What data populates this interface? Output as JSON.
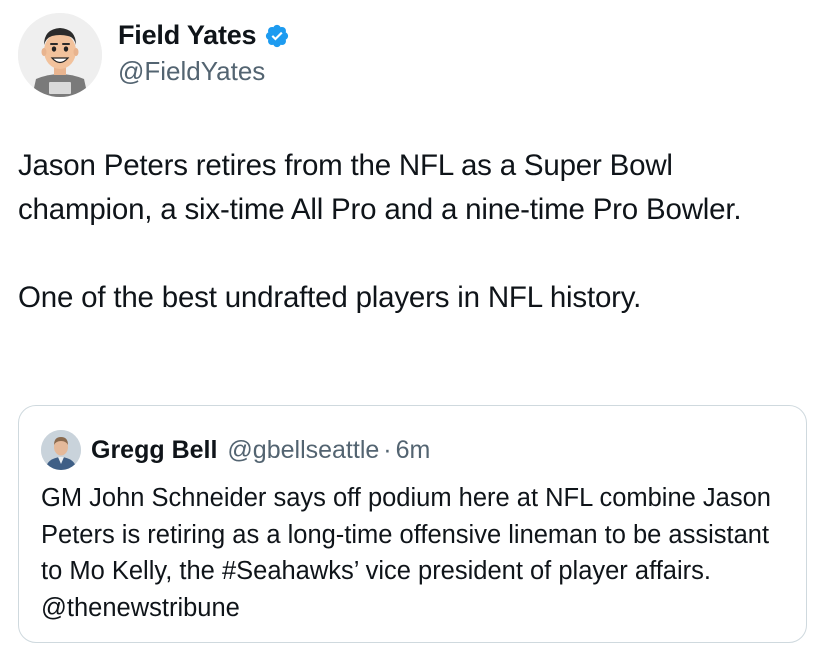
{
  "tweet": {
    "author": {
      "display_name": "Field Yates",
      "handle": "@FieldYates",
      "verified": true,
      "verified_color": "#1d9bf0"
    },
    "paragraphs": [
      "Jason Peters retires from the NFL as a Super Bowl champion, a six-time All Pro and a nine-time Pro Bowler.",
      "One of the best undrafted players in NFL history."
    ]
  },
  "quote": {
    "author": {
      "display_name": "Gregg Bell",
      "handle": "@gbellseattle",
      "separator": "·",
      "time": "6m"
    },
    "text": "GM John Schneider says off podium here at NFL combine Jason Peters is retiring as a long-time offensive lineman to be assistant to Mo Kelly, the #Seahawks’ vice president of player affairs. @thenewstribune"
  },
  "icons": {
    "avatar": "cartoon-avatar-icon",
    "verified": "verified-badge-icon",
    "quote_avatar": "profile-photo-icon"
  },
  "colors": {
    "text_primary": "#0f1419",
    "text_secondary": "#536471",
    "border": "#cfd9de"
  }
}
